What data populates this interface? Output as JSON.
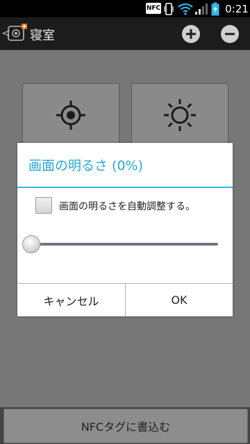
{
  "status_bar": {
    "nfc_label": "NFC",
    "time": "0:21",
    "icons": [
      "nfc-icon",
      "vibrate-icon",
      "wifi-icon",
      "signal-icon",
      "battery-charging-icon"
    ]
  },
  "action_bar": {
    "back_glyph": "<",
    "title": "寝室",
    "icons": [
      "nfc-app-icon",
      "add-icon",
      "remove-icon"
    ]
  },
  "content": {
    "tiles": [
      {
        "icon": "location-target-icon"
      },
      {
        "icon": "brightness-sun-icon"
      }
    ]
  },
  "dialog": {
    "title": "画面の明るさ (0%)",
    "checkbox_label": "画面の明るさを自動調整する。",
    "checkbox_checked": false,
    "slider_value_percent": 0,
    "cancel_label": "キャンセル",
    "ok_label": "OK"
  },
  "bottom": {
    "write_button_label": "NFCタグに書込む"
  },
  "colors": {
    "accent": "#33b5e5",
    "title_text": "#27a7d6"
  }
}
